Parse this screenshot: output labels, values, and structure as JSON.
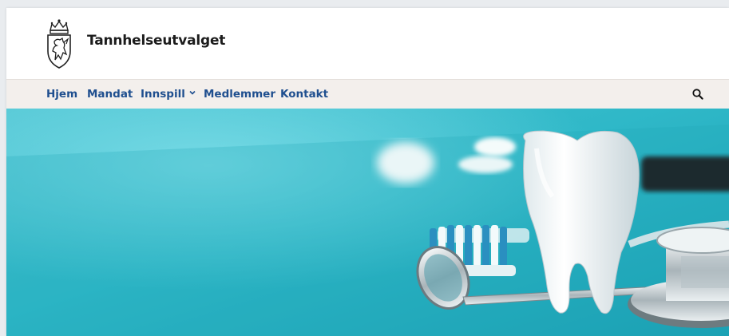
{
  "site": {
    "title": "Tannhelseutvalget"
  },
  "nav": {
    "items": [
      {
        "label": "Hjem"
      },
      {
        "label": "Mandat"
      },
      {
        "label": "Innspill",
        "has_dropdown": true
      },
      {
        "label": "Medlemmer"
      },
      {
        "label": "Kontakt"
      }
    ]
  },
  "icons": {
    "logo": "norwegian-coat-of-arms-icon",
    "search": "search-icon",
    "dropdown": "chevron-down-icon"
  },
  "colors": {
    "nav_text": "#1f4f8f",
    "nav_background": "#f3efec",
    "title_text": "#1c1c1c",
    "hero_background": "#2fb8c8"
  }
}
